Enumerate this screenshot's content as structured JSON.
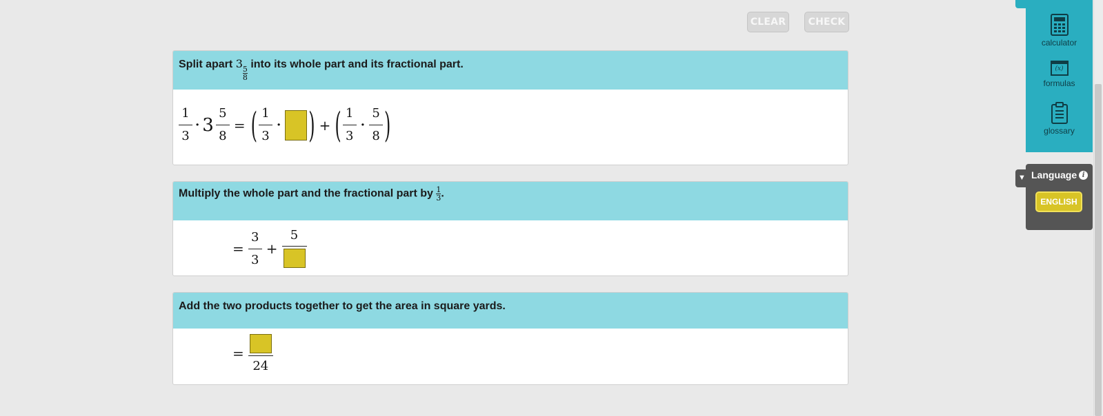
{
  "toolbar": {
    "clear_label": "CLEAR",
    "check_label": "CHECK"
  },
  "steps": [
    {
      "prompt_pre": "Split apart",
      "prompt_whole": "3",
      "prompt_num": "5",
      "prompt_den": "8",
      "prompt_post": "into its whole part and its fractional part.",
      "eq": {
        "a_num": "1",
        "a_den": "3",
        "dot": "·",
        "whole": "3",
        "m_num": "5",
        "m_den": "8",
        "eq": "=",
        "lp": "(",
        "rp": ")",
        "plus": "+"
      }
    },
    {
      "prompt_pre": "Multiply the whole part and the fractional part by",
      "prompt_num": "1",
      "prompt_den": "3",
      "prompt_post": ".",
      "eq": {
        "eq": "=",
        "a_num": "3",
        "a_den": "3",
        "plus": "+",
        "b_num": "5"
      }
    },
    {
      "prompt": "Add the two products together to get the area in square yards.",
      "eq": {
        "eq": "=",
        "den": "24"
      }
    }
  ],
  "sidebar": {
    "items": [
      {
        "label": "calculator",
        "icon": "calculator-icon"
      },
      {
        "label": "formulas",
        "icon": "formulas-icon",
        "glyph": "(x)"
      },
      {
        "label": "glossary",
        "icon": "glossary-icon"
      }
    ]
  },
  "language": {
    "title": "Language",
    "info": "i",
    "button": "ENGLISH",
    "caret": "▼"
  },
  "colors": {
    "header": "#8ed9e2",
    "answer_box": "#d8c426",
    "sidebar": "#2aaec0",
    "language_bg": "#555555"
  }
}
